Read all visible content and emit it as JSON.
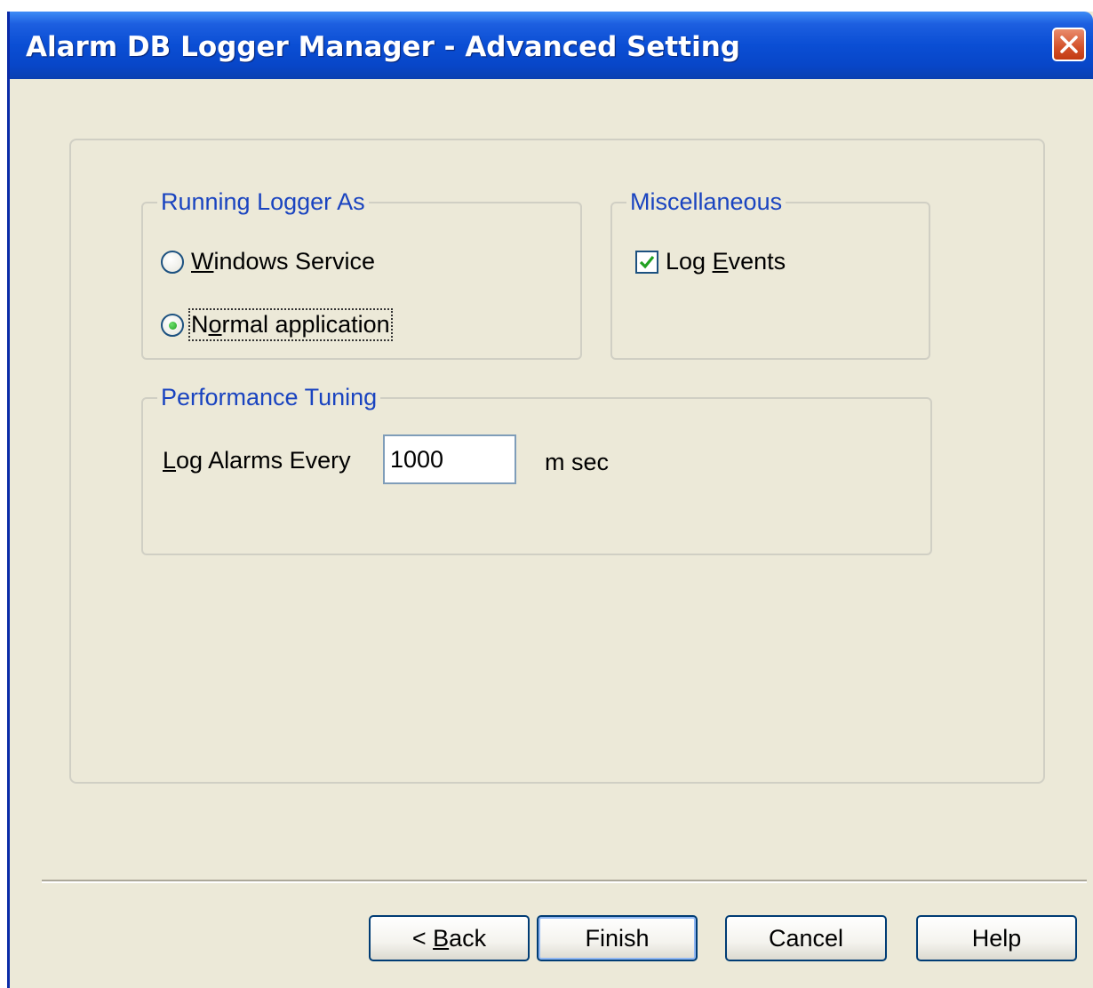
{
  "window": {
    "title": "Alarm DB Logger Manager - Advanced Setting",
    "close_icon": "close-icon"
  },
  "running_logger": {
    "legend": "Running Logger As",
    "options": [
      {
        "pre": "",
        "accel": "W",
        "post": "indows Service",
        "selected": false
      },
      {
        "pre": "N",
        "accel": "o",
        "post": "rmal application",
        "selected": true
      }
    ]
  },
  "misc": {
    "legend": "Miscellaneous",
    "log_events": {
      "pre": "Log ",
      "accel": "E",
      "post": "vents",
      "checked": true
    }
  },
  "performance": {
    "legend": "Performance Tuning",
    "label_accel": "L",
    "label_rest": "og Alarms Every",
    "value": "1000",
    "unit": "m sec"
  },
  "buttons": {
    "back_prefix": "< ",
    "back_accel": "B",
    "back_rest": "ack",
    "finish": "Finish",
    "cancel": "Cancel",
    "help": "Help"
  },
  "colors": {
    "titlebar": "#0a4ed4",
    "legend_text": "#1a44c0",
    "dialog_bg": "#ece9d8",
    "check_mark": "#21a121"
  }
}
